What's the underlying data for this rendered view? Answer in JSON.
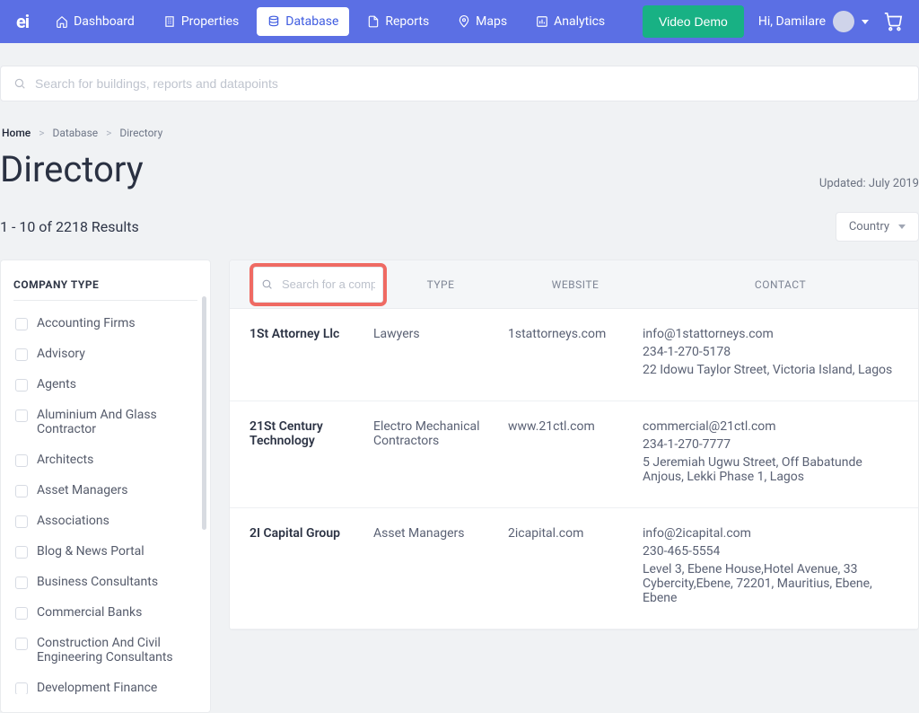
{
  "brand": "ei",
  "nav": {
    "items": [
      {
        "label": "Dashboard",
        "icon": "home"
      },
      {
        "label": "Properties",
        "icon": "building"
      },
      {
        "label": "Database",
        "icon": "database",
        "active": true
      },
      {
        "label": "Reports",
        "icon": "doc"
      },
      {
        "label": "Maps",
        "icon": "pin"
      },
      {
        "label": "Analytics",
        "icon": "chart"
      }
    ],
    "demo_button": "Video Demo",
    "user_greeting": "Hi,  Damilare"
  },
  "global_search_placeholder": "Search for buildings, reports and datapoints",
  "breadcrumb": {
    "home": "Home",
    "l1": "Database",
    "l2": "Directory"
  },
  "page": {
    "title": "Directory",
    "updated": "Updated: July 2019"
  },
  "results": {
    "label": "1 - 10 of 2218 Results",
    "country_label": "Country"
  },
  "sidebar": {
    "heading": "COMPANY TYPE",
    "filters": [
      "Accounting Firms",
      "Advisory",
      "Agents",
      "Aluminium And Glass Contractor",
      "Architects",
      "Asset Managers",
      "Associations",
      "Blog & News Portal",
      "Business Consultants",
      "Commercial Banks",
      "Construction And Civil Engineering Consultants",
      "Development Finance"
    ]
  },
  "table": {
    "company_search_placeholder": "Search for a compa",
    "headers": {
      "type": "TYPE",
      "website": "WEBSITE",
      "contact": "CONTACT"
    },
    "rows": [
      {
        "name": "1St Attorney Llc",
        "type": "Lawyers",
        "website": "1stattorneys.com",
        "email": "info@1stattorneys.com",
        "phone": "234-1-270-5178",
        "address": "22 Idowu Taylor Street, Victoria Island, Lagos"
      },
      {
        "name": "21St Century Technology",
        "type": "Electro Mechanical Contractors",
        "website": "www.21ctl.com",
        "email": "commercial@21ctl.com",
        "phone": "234-1-270-7777",
        "address": "5 Jeremiah Ugwu Street, Off Babatunde Anjous, Lekki Phase 1, Lagos"
      },
      {
        "name": "2I Capital Group",
        "type": "Asset Managers",
        "website": "2icapital.com",
        "email": "info@2icapital.com",
        "phone": "230-465-5554",
        "address": "Level 3, Ebene House,Hotel Avenue, 33 Cybercity,Ebene, 72201, Mauritius, Ebene, Ebene"
      }
    ]
  }
}
